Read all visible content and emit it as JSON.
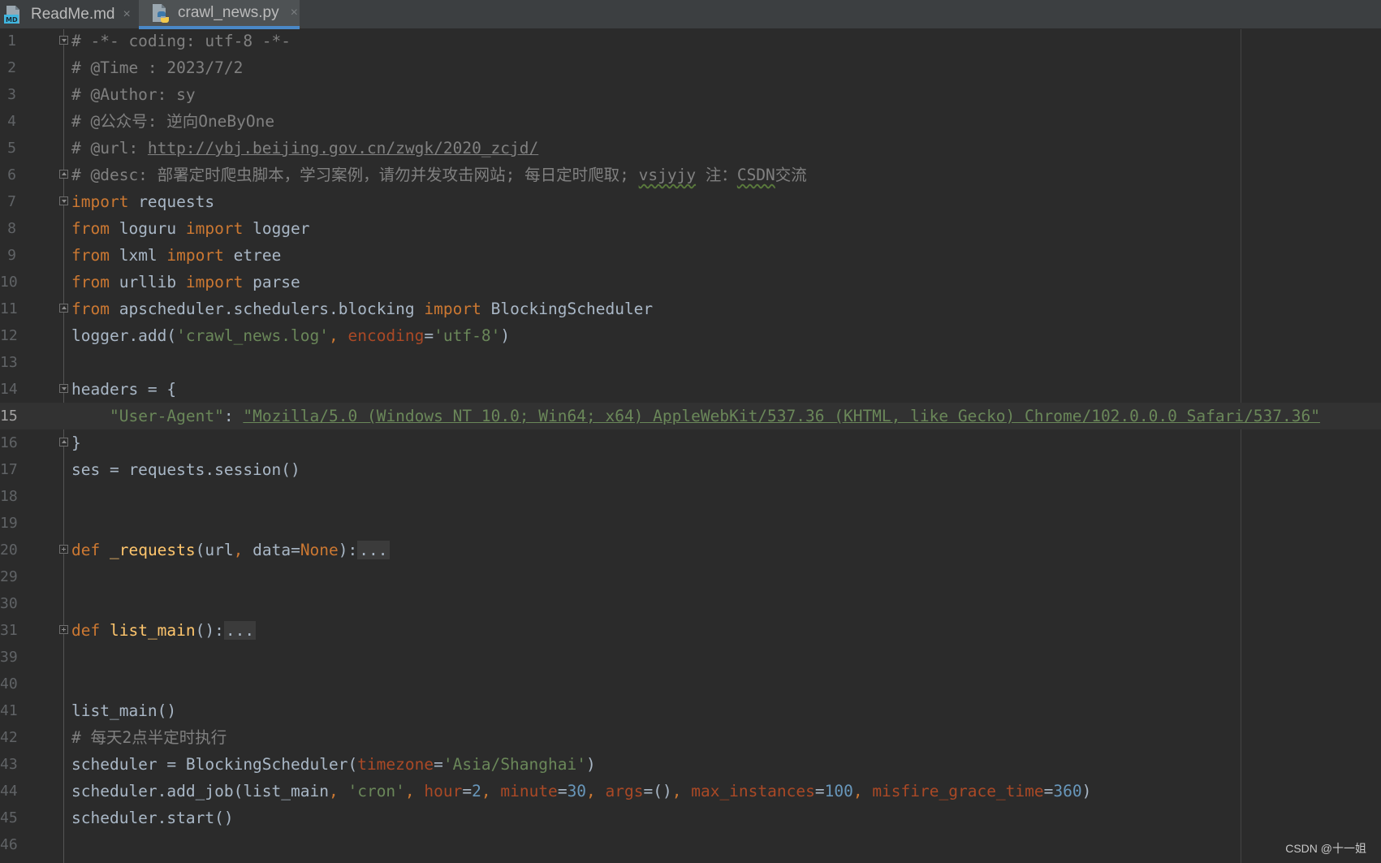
{
  "tabs": [
    {
      "label": "ReadMe.md",
      "close": "×",
      "icon": "markdown-file-icon",
      "active": false
    },
    {
      "label": "crawl_news.py",
      "close": "×",
      "icon": "python-file-icon",
      "active": true
    }
  ],
  "current_line": "15",
  "code_lines": [
    {
      "n": "1",
      "fold": "down",
      "tokens": [
        {
          "t": "# -*- coding: utf-8 -*-",
          "c": "cm"
        }
      ]
    },
    {
      "n": "2",
      "tokens": [
        {
          "t": "# @Time : 2023/7/2",
          "c": "cm"
        }
      ]
    },
    {
      "n": "3",
      "tokens": [
        {
          "t": "# @Author: sy",
          "c": "cm"
        }
      ]
    },
    {
      "n": "4",
      "tokens": [
        {
          "t": "# @公众号: 逆向OneByOne",
          "c": "cm"
        }
      ]
    },
    {
      "n": "5",
      "tokens": [
        {
          "t": "# @url: ",
          "c": "cm"
        },
        {
          "t": "http://ybj.beijing.gov.cn/zwgk/2020_zcjd/",
          "c": "cm url"
        }
      ]
    },
    {
      "n": "6",
      "fold": "up",
      "tokens": [
        {
          "t": "# @desc: 部署定时爬虫脚本，学习案例，请勿并发攻击网站; 每日定时爬取; ",
          "c": "cm"
        },
        {
          "t": "vsjyjy",
          "c": "cm typo"
        },
        {
          "t": " 注：",
          "c": "cm"
        },
        {
          "t": "CSDN",
          "c": "cm typo"
        },
        {
          "t": "交流",
          "c": "cm"
        }
      ]
    },
    {
      "n": "7",
      "fold": "down",
      "tokens": [
        {
          "t": "import",
          "c": "kw"
        },
        {
          "t": " requests",
          "c": ""
        }
      ]
    },
    {
      "n": "8",
      "tokens": [
        {
          "t": "from",
          "c": "kw"
        },
        {
          "t": " loguru ",
          "c": ""
        },
        {
          "t": "import",
          "c": "kw"
        },
        {
          "t": " logger",
          "c": ""
        }
      ]
    },
    {
      "n": "9",
      "tokens": [
        {
          "t": "from",
          "c": "kw"
        },
        {
          "t": " lxml ",
          "c": ""
        },
        {
          "t": "import",
          "c": "kw"
        },
        {
          "t": " etree",
          "c": ""
        }
      ]
    },
    {
      "n": "10",
      "tokens": [
        {
          "t": "from",
          "c": "kw"
        },
        {
          "t": " urllib ",
          "c": ""
        },
        {
          "t": "import",
          "c": "kw"
        },
        {
          "t": " parse",
          "c": ""
        }
      ]
    },
    {
      "n": "11",
      "fold": "up",
      "tokens": [
        {
          "t": "from",
          "c": "kw"
        },
        {
          "t": " apscheduler.schedulers.blocking ",
          "c": ""
        },
        {
          "t": "import",
          "c": "kw"
        },
        {
          "t": " BlockingScheduler",
          "c": ""
        }
      ]
    },
    {
      "n": "12",
      "tokens": [
        {
          "t": "logger.add(",
          "c": ""
        },
        {
          "t": "'crawl_news.log'",
          "c": "st"
        },
        {
          "t": ", ",
          "c": "kw"
        },
        {
          "t": "encoding",
          "c": "pr"
        },
        {
          "t": "=",
          "c": ""
        },
        {
          "t": "'utf-8'",
          "c": "st"
        },
        {
          "t": ")",
          "c": ""
        }
      ]
    },
    {
      "n": "13",
      "tokens": []
    },
    {
      "n": "14",
      "fold": "down",
      "tokens": [
        {
          "t": "headers = {",
          "c": ""
        }
      ]
    },
    {
      "n": "15",
      "tokens": [
        {
          "t": "    ",
          "c": ""
        },
        {
          "t": "\"User-Agent\"",
          "c": "st"
        },
        {
          "t": ": ",
          "c": ""
        },
        {
          "t": "\"Mozilla/5.0 (Windows NT 10.0; Win64; x64) AppleWebKit/537.36 (KHTML, like Gecko) Chrome/102.0.0.0 Safari/537.36\"",
          "c": "st url"
        }
      ]
    },
    {
      "n": "16",
      "fold": "up",
      "tokens": [
        {
          "t": "}",
          "c": ""
        }
      ]
    },
    {
      "n": "17",
      "tokens": [
        {
          "t": "ses = requests.session()",
          "c": ""
        }
      ]
    },
    {
      "n": "18",
      "tokens": []
    },
    {
      "n": "19",
      "tokens": []
    },
    {
      "n": "20",
      "fold": "plus",
      "tokens": [
        {
          "t": "def",
          "c": "kw"
        },
        {
          "t": " ",
          "c": ""
        },
        {
          "t": "_requests",
          "c": "fn"
        },
        {
          "t": "(url",
          "c": ""
        },
        {
          "t": ", ",
          "c": "kw"
        },
        {
          "t": "data=",
          "c": ""
        },
        {
          "t": "None",
          "c": "kw"
        },
        {
          "t": "):",
          "c": ""
        },
        {
          "t": "...",
          "c": "folded"
        }
      ]
    },
    {
      "n": "29",
      "tokens": []
    },
    {
      "n": "30",
      "tokens": []
    },
    {
      "n": "31",
      "fold": "plus",
      "tokens": [
        {
          "t": "def",
          "c": "kw"
        },
        {
          "t": " ",
          "c": ""
        },
        {
          "t": "list_main",
          "c": "fn"
        },
        {
          "t": "():",
          "c": ""
        },
        {
          "t": "...",
          "c": "folded"
        }
      ]
    },
    {
      "n": "39",
      "tokens": []
    },
    {
      "n": "40",
      "tokens": []
    },
    {
      "n": "41",
      "tokens": [
        {
          "t": "list_main()",
          "c": ""
        }
      ]
    },
    {
      "n": "42",
      "tokens": [
        {
          "t": "# 每天2点半定时执行",
          "c": "cm"
        }
      ]
    },
    {
      "n": "43",
      "tokens": [
        {
          "t": "scheduler = BlockingScheduler(",
          "c": ""
        },
        {
          "t": "timezone",
          "c": "pr"
        },
        {
          "t": "=",
          "c": ""
        },
        {
          "t": "'Asia/Shanghai'",
          "c": "st"
        },
        {
          "t": ")",
          "c": ""
        }
      ]
    },
    {
      "n": "44",
      "tokens": [
        {
          "t": "scheduler.add_job(list_main",
          "c": ""
        },
        {
          "t": ", ",
          "c": "kw"
        },
        {
          "t": "'cron'",
          "c": "st"
        },
        {
          "t": ", ",
          "c": "kw"
        },
        {
          "t": "hour",
          "c": "pr"
        },
        {
          "t": "=",
          "c": ""
        },
        {
          "t": "2",
          "c": "nm"
        },
        {
          "t": ", ",
          "c": "kw"
        },
        {
          "t": "minute",
          "c": "pr"
        },
        {
          "t": "=",
          "c": ""
        },
        {
          "t": "30",
          "c": "nm"
        },
        {
          "t": ", ",
          "c": "kw"
        },
        {
          "t": "args",
          "c": "pr"
        },
        {
          "t": "=()",
          "c": ""
        },
        {
          "t": ", ",
          "c": "kw"
        },
        {
          "t": "max_instances",
          "c": "pr"
        },
        {
          "t": "=",
          "c": ""
        },
        {
          "t": "100",
          "c": "nm"
        },
        {
          "t": ", ",
          "c": "kw"
        },
        {
          "t": "misfire_grace_time",
          "c": "pr"
        },
        {
          "t": "=",
          "c": ""
        },
        {
          "t": "360",
          "c": "nm"
        },
        {
          "t": ")",
          "c": ""
        }
      ]
    },
    {
      "n": "45",
      "tokens": [
        {
          "t": "scheduler.start()",
          "c": ""
        }
      ]
    },
    {
      "n": "46",
      "tokens": []
    }
  ],
  "watermark": "CSDN @十一姐",
  "colors": {
    "background": "#2b2b2b",
    "tabbar": "#3c3f41",
    "active_tab": "#4e5254",
    "keyword": "#cc7832",
    "comment": "#808080",
    "string": "#6a8759",
    "number": "#6897bb",
    "param": "#aa4926",
    "function": "#ffc66d",
    "text": "#a9b7c6"
  }
}
